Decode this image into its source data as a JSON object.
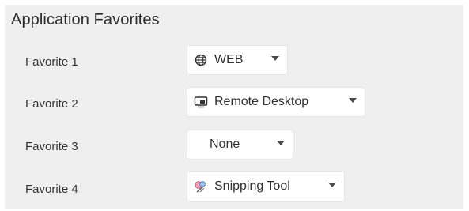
{
  "section": {
    "title": "Application Favorites"
  },
  "favorites": [
    {
      "label": "Favorite 1",
      "value": "WEB",
      "icon": "globe-icon"
    },
    {
      "label": "Favorite 2",
      "value": "Remote Desktop",
      "icon": "remote-desktop-icon"
    },
    {
      "label": "Favorite 3",
      "value": "None",
      "icon": ""
    },
    {
      "label": "Favorite 4",
      "value": "Snipping Tool",
      "icon": "snipping-tool-icon"
    }
  ]
}
